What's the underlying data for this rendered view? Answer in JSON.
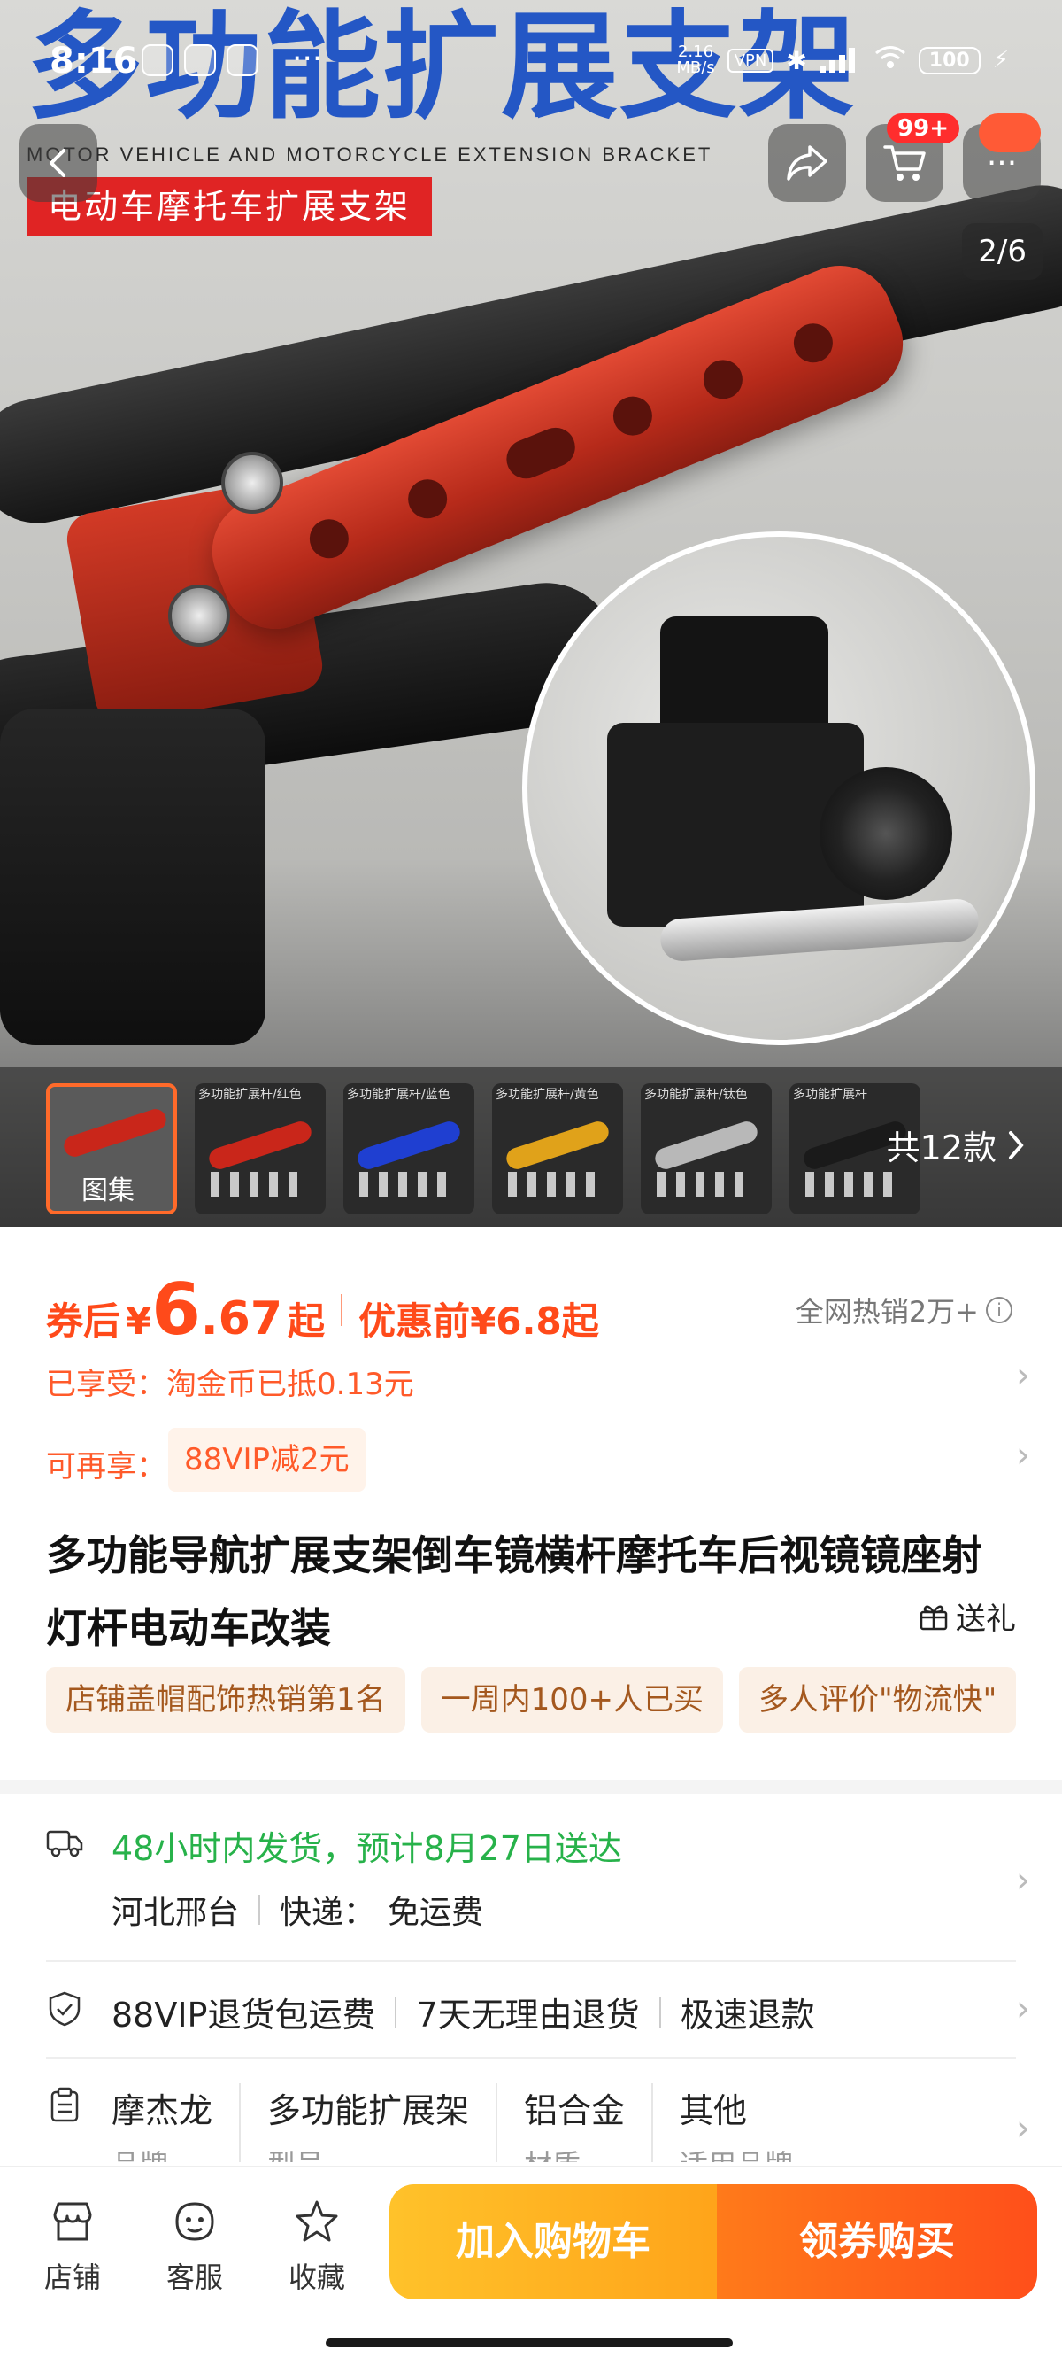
{
  "status_bar": {
    "time": "8:16",
    "net_speed_value": "2.16",
    "net_speed_unit": "MB/s",
    "vpn": "VPN",
    "battery": "100"
  },
  "hero": {
    "title_big": "多功能扩展支架",
    "subtitle_en": "MOTOR VEHICLE AND MOTORCYCLE EXTENSION BRACKET",
    "subtitle_cn": "电动车摩托车扩展支架",
    "image_counter": "2/6"
  },
  "nav": {
    "cart_badge": "99+"
  },
  "thumbnails": {
    "album_label": "图集",
    "items": [
      {
        "label": "多功能扩展杆/红色",
        "color": "#c9261a"
      },
      {
        "label": "多功能扩展杆/蓝色",
        "color": "#1f3fd1"
      },
      {
        "label": "多功能扩展杆/黄色",
        "color": "#e0a21a"
      },
      {
        "label": "多功能扩展杆/钛色",
        "color": "#b8b8b8"
      },
      {
        "label": "多功能扩展杆",
        "color": "#1a1a1a"
      }
    ],
    "count_label": "共12款"
  },
  "price": {
    "label": "券后",
    "yen": "¥",
    "integer": "6",
    "decimal": ".67",
    "suffix": "起",
    "original": "优惠前¥6.8起",
    "sales": "全网热销2万+"
  },
  "promotions": {
    "enjoyed": "已享受：淘金币已抵0.13元",
    "more_label": "可再享：",
    "more_tag": "88VIP减2元"
  },
  "product": {
    "title": "多功能导航扩展支架倒车镜横杆摩托车后视镜镜座射灯杆电动车改装",
    "gift": "送礼",
    "tags": [
      "店铺盖帽配饰热销第1名",
      "一周内100+人已买",
      "多人评价\"物流快\""
    ]
  },
  "shipping": {
    "line1": "48小时内发货，预计8月27日送达",
    "origin": "河北邢台",
    "courier_label": "快递：",
    "fee": "免运费"
  },
  "guarantees": [
    "88VIP退货包运费",
    "7天无理由退货",
    "极速退款"
  ],
  "specs": [
    {
      "value": "摩杰龙",
      "key": "品牌"
    },
    {
      "value": "多功能扩展架",
      "key": "型号"
    },
    {
      "value": "铝合金",
      "key": "材质"
    },
    {
      "value": "其他",
      "key": "适用品牌"
    }
  ],
  "bottom_bar": {
    "store": "店铺",
    "service": "客服",
    "favorite": "收藏",
    "add_to_cart": "加入购物车",
    "buy": "领券购买"
  },
  "colors": {
    "accent": "#ff4a1a",
    "ship_green": "#27b24a",
    "title_blue": "#2457c5"
  }
}
